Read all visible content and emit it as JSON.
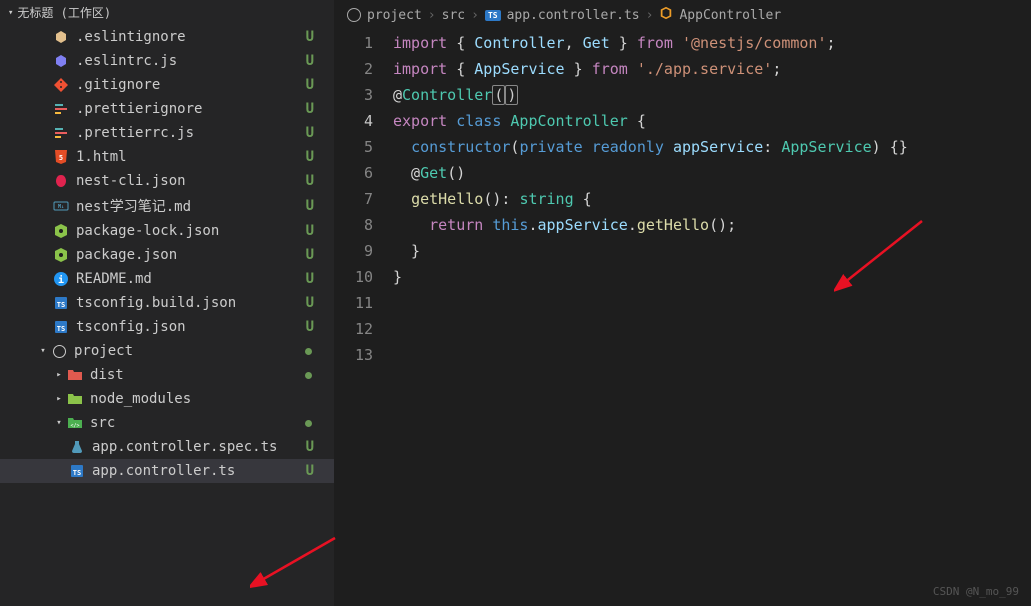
{
  "workspace": {
    "title": "无标题 (工作区)"
  },
  "tree": {
    "root_files": [
      {
        "name": ".eslintignore",
        "icon": "eslint",
        "color": "#e2c08d",
        "status": "U"
      },
      {
        "name": ".eslintrc.js",
        "icon": "eslint",
        "color": "#8080f2",
        "status": "U"
      },
      {
        "name": ".gitignore",
        "icon": "git",
        "color": "#f05133",
        "status": "U"
      },
      {
        "name": ".prettierignore",
        "icon": "prettier",
        "color": "#56b3b4",
        "status": "U"
      },
      {
        "name": ".prettierrc.js",
        "icon": "prettier",
        "color": "#56b3b4",
        "status": "U"
      },
      {
        "name": "1.html",
        "icon": "html",
        "color": "#e44d26",
        "status": "U"
      },
      {
        "name": "nest-cli.json",
        "icon": "nest",
        "color": "#e0234e",
        "status": "U"
      },
      {
        "name": "nest学习笔记.md",
        "icon": "md",
        "color": "#519aba",
        "status": "U"
      },
      {
        "name": "package-lock.json",
        "icon": "npm",
        "color": "#8bc34a",
        "status": "U"
      },
      {
        "name": "package.json",
        "icon": "npm",
        "color": "#8bc34a",
        "status": "U"
      },
      {
        "name": "README.md",
        "icon": "info",
        "color": "#2196f3",
        "status": "U"
      },
      {
        "name": "tsconfig.build.json",
        "icon": "tsconfig",
        "color": "#2d79c7",
        "status": "U"
      },
      {
        "name": "tsconfig.json",
        "icon": "tsconfig",
        "color": "#2d79c7",
        "status": "U"
      }
    ],
    "project": {
      "label": "project",
      "expanded": true
    },
    "project_children": [
      {
        "name": "dist",
        "type": "folder",
        "color": "#e05a4f",
        "expanded": false,
        "dot": true
      },
      {
        "name": "node_modules",
        "type": "folder",
        "color": "#8bc34a",
        "expanded": false
      },
      {
        "name": "src",
        "type": "folder",
        "color": "#4caf50",
        "expanded": true,
        "dot": true
      }
    ],
    "src_children": [
      {
        "name": "app.controller.spec.ts",
        "icon": "test",
        "color": "#519aba",
        "status": "U"
      },
      {
        "name": "app.controller.ts",
        "icon": "ts",
        "color": "#2d79c7",
        "status": "U",
        "active": true
      }
    ]
  },
  "breadcrumb": {
    "parts": [
      "project",
      "src",
      "app.controller.ts",
      "AppController"
    ]
  },
  "code": {
    "lines": [
      {
        "num": 1,
        "tokens": [
          [
            "k-import",
            "import"
          ],
          [
            "punct",
            " { "
          ],
          [
            "var",
            "Controller"
          ],
          [
            "punct",
            ", "
          ],
          [
            "var",
            "Get"
          ],
          [
            "punct",
            " } "
          ],
          [
            "k-from",
            "from"
          ],
          [
            "punct",
            " "
          ],
          [
            "str",
            "'@nestjs/common'"
          ],
          [
            "punct",
            ";"
          ]
        ]
      },
      {
        "num": 2,
        "tokens": [
          [
            "k-import",
            "import"
          ],
          [
            "punct",
            " { "
          ],
          [
            "var",
            "AppService"
          ],
          [
            "punct",
            " } "
          ],
          [
            "k-from",
            "from"
          ],
          [
            "punct",
            " "
          ],
          [
            "str",
            "'./app.service'"
          ],
          [
            "punct",
            ";"
          ]
        ]
      },
      {
        "num": 3,
        "tokens": [
          [
            "punct",
            ""
          ]
        ]
      },
      {
        "num": 4,
        "current": true,
        "tokens": [
          [
            "punct",
            "@"
          ],
          [
            "decorator",
            "Controller"
          ],
          [
            "brace-hl",
            "("
          ],
          [
            "brace-hl",
            ")"
          ]
        ]
      },
      {
        "num": 5,
        "tokens": [
          [
            "k-export",
            "export"
          ],
          [
            "punct",
            " "
          ],
          [
            "k-class",
            "class"
          ],
          [
            "punct",
            " "
          ],
          [
            "cls-name",
            "AppController"
          ],
          [
            "punct",
            " {"
          ]
        ]
      },
      {
        "num": 6,
        "tokens": [
          [
            "punct",
            "  "
          ],
          [
            "k-class",
            "constructor"
          ],
          [
            "punct",
            "("
          ],
          [
            "k-private",
            "private"
          ],
          [
            "punct",
            " "
          ],
          [
            "k-readonly",
            "readonly"
          ],
          [
            "punct",
            " "
          ],
          [
            "var",
            "appService"
          ],
          [
            "punct",
            ": "
          ],
          [
            "cls-name",
            "AppService"
          ],
          [
            "punct",
            ") {}"
          ]
        ]
      },
      {
        "num": 7,
        "tokens": [
          [
            "punct",
            ""
          ]
        ]
      },
      {
        "num": 8,
        "tokens": [
          [
            "punct",
            "  @"
          ],
          [
            "decorator",
            "Get"
          ],
          [
            "punct",
            "()"
          ]
        ]
      },
      {
        "num": 9,
        "tokens": [
          [
            "punct",
            "  "
          ],
          [
            "fn-name",
            "getHello"
          ],
          [
            "punct",
            "(): "
          ],
          [
            "type-str",
            "string"
          ],
          [
            "punct",
            " {"
          ]
        ]
      },
      {
        "num": 10,
        "tokens": [
          [
            "punct",
            "    "
          ],
          [
            "k-return",
            "return"
          ],
          [
            "punct",
            " "
          ],
          [
            "k-this",
            "this"
          ],
          [
            "punct",
            "."
          ],
          [
            "var",
            "appService"
          ],
          [
            "punct",
            "."
          ],
          [
            "fn-name",
            "getHello"
          ],
          [
            "punct",
            "();"
          ]
        ]
      },
      {
        "num": 11,
        "tokens": [
          [
            "punct",
            "  }"
          ]
        ]
      },
      {
        "num": 12,
        "tokens": [
          [
            "punct",
            "}"
          ]
        ]
      },
      {
        "num": 13,
        "tokens": [
          [
            "punct",
            ""
          ]
        ]
      }
    ]
  },
  "watermark": "CSDN @N_mo_99"
}
